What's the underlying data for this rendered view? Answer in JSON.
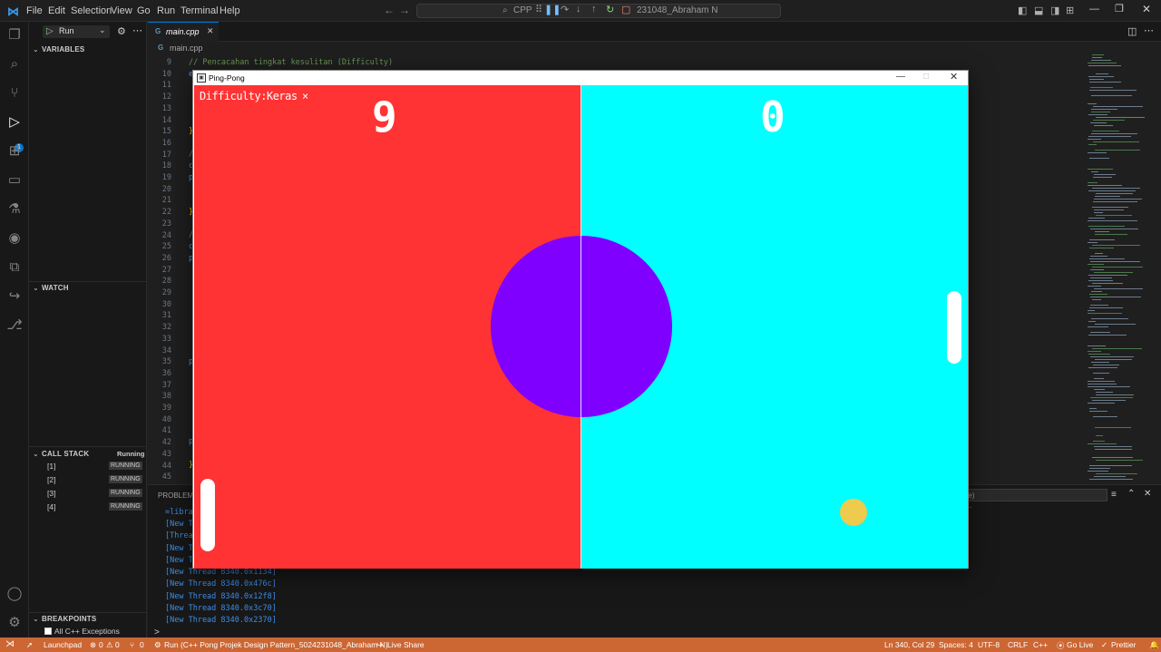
{
  "titlebar": {
    "menu": [
      "File",
      "Edit",
      "Selection",
      "View",
      "Go",
      "Run",
      "Terminal",
      "Help"
    ],
    "command_center": "C++ Pong Projek Design Pattern_5024231048_Abraham N",
    "command_center_visible": "231048_Abraham N",
    "search_prefix": "CPP"
  },
  "sidebar": {
    "run_label": "Run",
    "variables_title": "VARIABLES",
    "watch_title": "WATCH",
    "call_stack_title": "CALL STACK",
    "call_stack_status": "Running",
    "threads": [
      {
        "name": "[1]",
        "state": "RUNNING"
      },
      {
        "name": "[2]",
        "state": "RUNNING"
      },
      {
        "name": "[3]",
        "state": "RUNNING"
      },
      {
        "name": "[4]",
        "state": "RUNNING"
      }
    ],
    "breakpoints_title": "BREAKPOINTS",
    "breakpoint_item": "All C++ Exceptions"
  },
  "editor": {
    "tab_label": "main.cpp",
    "breadcrumb": "main.cpp",
    "line_numbers": [
      "9",
      "10",
      "11",
      "12",
      "13",
      "14",
      "15",
      "16",
      "17",
      "18",
      "19",
      "20",
      "21",
      "22",
      "23",
      "24",
      "25",
      "26",
      "27",
      "28",
      "29",
      "30",
      "31",
      "32",
      "33",
      "34",
      "35",
      "36",
      "37",
      "38",
      "39",
      "40",
      "41",
      "42",
      "43",
      "44",
      "45"
    ],
    "comment_line": "// Pencacahan tingkat kesulitan (Difficulty)"
  },
  "panel": {
    "problems_tab": "PROBLEMS",
    "terminal_lines": [
      "=libra",
      "[New T",
      "[Threa",
      "[New T",
      "[New T",
      "[New Thread 8340.0x1134]",
      "[New Thread 8340.0x476c]",
      "[New Thread 8340.0x12f8]",
      "[New Thread 8340.0x3c70]",
      "[New Thread 8340.0x2370]"
    ],
    "filter_suffix": "e)",
    "prompt": ">"
  },
  "game": {
    "window_title": "Ping-Pong",
    "difficulty_text": "Difficulty:Keras",
    "difficulty_close": "×",
    "score_left": "9",
    "score_right": "0",
    "colors": {
      "left_half": "#ff3333",
      "right_half": "#00ffff",
      "center_circle": "#7f00ff",
      "ball": "#eeca4d",
      "paddle": "#ffffff"
    }
  },
  "statusbar": {
    "launchpad": "Launchpad",
    "errors": "0",
    "warnings": "0",
    "ports": "0",
    "run_config": "Run (C++ Pong Projek Design Pattern_5024231048_Abraham N)",
    "live_share": "Live Share",
    "cursor": "Ln 340, Col 29",
    "spaces": "Spaces: 4",
    "encoding": "UTF-8",
    "eol": "CRLF",
    "language": "C++",
    "go_live": "Go Live",
    "prettier": "Prettier"
  }
}
